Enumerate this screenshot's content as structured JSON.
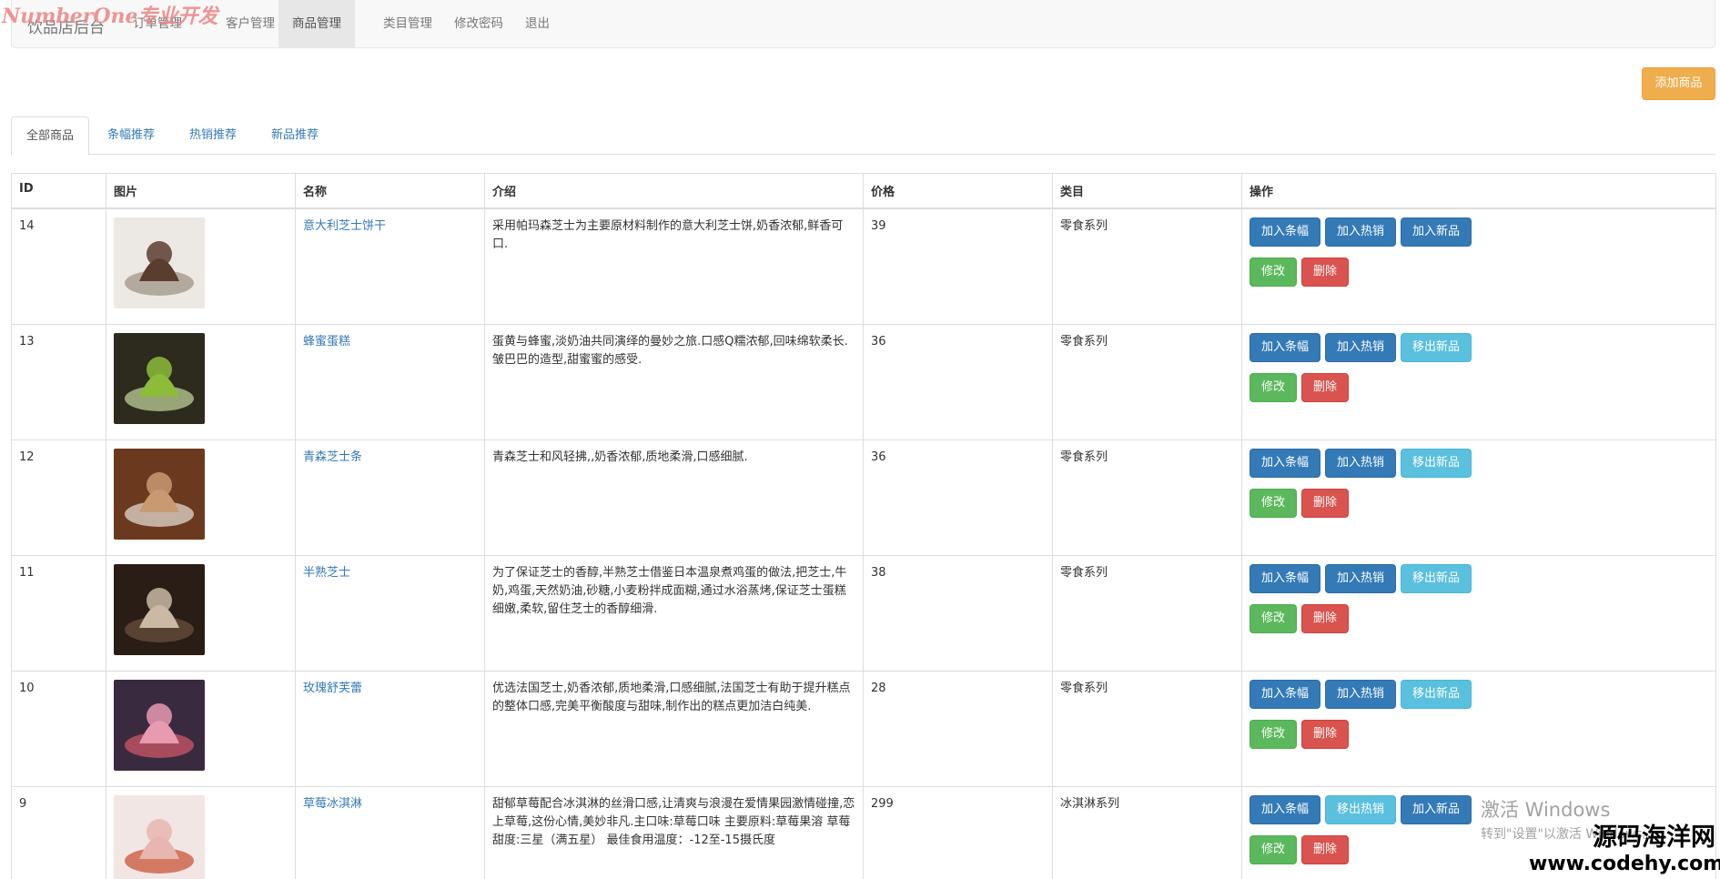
{
  "watermark_top": "NumberOne专业开发",
  "navbar": {
    "brand": "饮品店后台",
    "items": [
      {
        "label": "订单管理"
      },
      {
        "label": "客户管理"
      },
      {
        "label": "商品管理"
      },
      {
        "label": "类目管理"
      },
      {
        "label": "修改密码"
      },
      {
        "label": "退出"
      }
    ],
    "active_index": 2
  },
  "add_button": "添加商品",
  "tabs": [
    {
      "label": "全部商品"
    },
    {
      "label": "条幅推荐"
    },
    {
      "label": "热销推荐"
    },
    {
      "label": "新品推荐"
    }
  ],
  "table": {
    "headers": [
      "ID",
      "图片",
      "名称",
      "介绍",
      "价格",
      "类目",
      "操作"
    ],
    "rows": [
      {
        "id": "14",
        "name": "意大利芝士饼干",
        "desc": "采用帕玛森芝士为主要原材料制作的意大利芝士饼,奶香浓郁,鲜香可口.",
        "price": "39",
        "category": "零食系列",
        "ops": [
          {
            "label": "加入条幅",
            "style": "primary"
          },
          {
            "label": "加入热销",
            "style": "primary"
          },
          {
            "label": "加入新品",
            "style": "primary"
          }
        ],
        "image_colors": [
          "#ece9e4",
          "#5a3d2e",
          "#9a8e82"
        ]
      },
      {
        "id": "13",
        "name": "蜂蜜蛋糕",
        "desc": "蛋黄与蜂蜜,淡奶油共同演绎的曼妙之旅.口感Q糯浓郁,回味绵软柔长.皱巴巴的造型,甜蜜蜜的感受.",
        "price": "36",
        "category": "零食系列",
        "ops": [
          {
            "label": "加入条幅",
            "style": "primary"
          },
          {
            "label": "加入热销",
            "style": "primary"
          },
          {
            "label": "移出新品",
            "style": "info"
          }
        ],
        "image_colors": [
          "#2d2a1e",
          "#8cbc3a",
          "#c9d9a0"
        ]
      },
      {
        "id": "12",
        "name": "青森芝士条",
        "desc": "青森芝士和风轻拂,,奶香浓郁,质地柔滑,口感细腻.",
        "price": "36",
        "category": "零食系列",
        "ops": [
          {
            "label": "加入条幅",
            "style": "primary"
          },
          {
            "label": "加入热销",
            "style": "primary"
          },
          {
            "label": "移出新品",
            "style": "info"
          }
        ],
        "image_colors": [
          "#6b3a1e",
          "#c99a72",
          "#e8e2dc"
        ]
      },
      {
        "id": "11",
        "name": "半熟芝士",
        "desc": "为了保证芝士的香醇,半熟芝士借鉴日本温泉煮鸡蛋的做法,把芝士,牛奶,鸡蛋,天然奶油,砂糖,小麦粉拌成面糊,通过水浴蒸烤,保证芝士蛋糕细嫩,柔软,留住芝士的香醇细滑.",
        "price": "38",
        "category": "零食系列",
        "ops": [
          {
            "label": "加入条幅",
            "style": "primary"
          },
          {
            "label": "加入热销",
            "style": "primary"
          },
          {
            "label": "移出新品",
            "style": "info"
          }
        ],
        "image_colors": [
          "#2a1d16",
          "#cbb9a4",
          "#6e5240"
        ]
      },
      {
        "id": "10",
        "name": "玫瑰舒芙蕾",
        "desc": "优选法国芝士,奶香浓郁,质地柔滑,口感细腻,法国芝士有助于提升糕点的整体口感,完美平衡酸度与甜味,制作出的糕点更加洁白纯美.",
        "price": "28",
        "category": "零食系列",
        "ops": [
          {
            "label": "加入条幅",
            "style": "primary"
          },
          {
            "label": "加入热销",
            "style": "primary"
          },
          {
            "label": "移出新品",
            "style": "info"
          }
        ],
        "image_colors": [
          "#3a2a40",
          "#e79ab0",
          "#d75a6a"
        ]
      },
      {
        "id": "9",
        "name": "草莓冰淇淋",
        "desc": "甜郁草莓配合冰淇淋的丝滑口感,让清爽与浪漫在爱情果园激情碰撞,恋上草莓,这份心情,美妙非凡.主口味:草莓口味 主要原料:草莓果溶 草莓 甜度:三星（满五星） 最佳食用温度：-12至-15摄氏度",
        "price": "299",
        "category": "冰淇淋系列",
        "ops": [
          {
            "label": "加入条幅",
            "style": "primary"
          },
          {
            "label": "移出热销",
            "style": "info"
          },
          {
            "label": "加入新品",
            "style": "primary"
          }
        ],
        "image_colors": [
          "#f1e6e4",
          "#e8b6b0",
          "#c84a2c"
        ]
      }
    ],
    "row_actions": {
      "edit": "修改",
      "delete": "删除"
    }
  },
  "windows_watermark": {
    "line1": "激活 Windows",
    "line2": "转到\"设置\"以激活 Windows。"
  },
  "site_watermark": {
    "line1": "源码海洋网",
    "line2": "www.codehy.com"
  }
}
